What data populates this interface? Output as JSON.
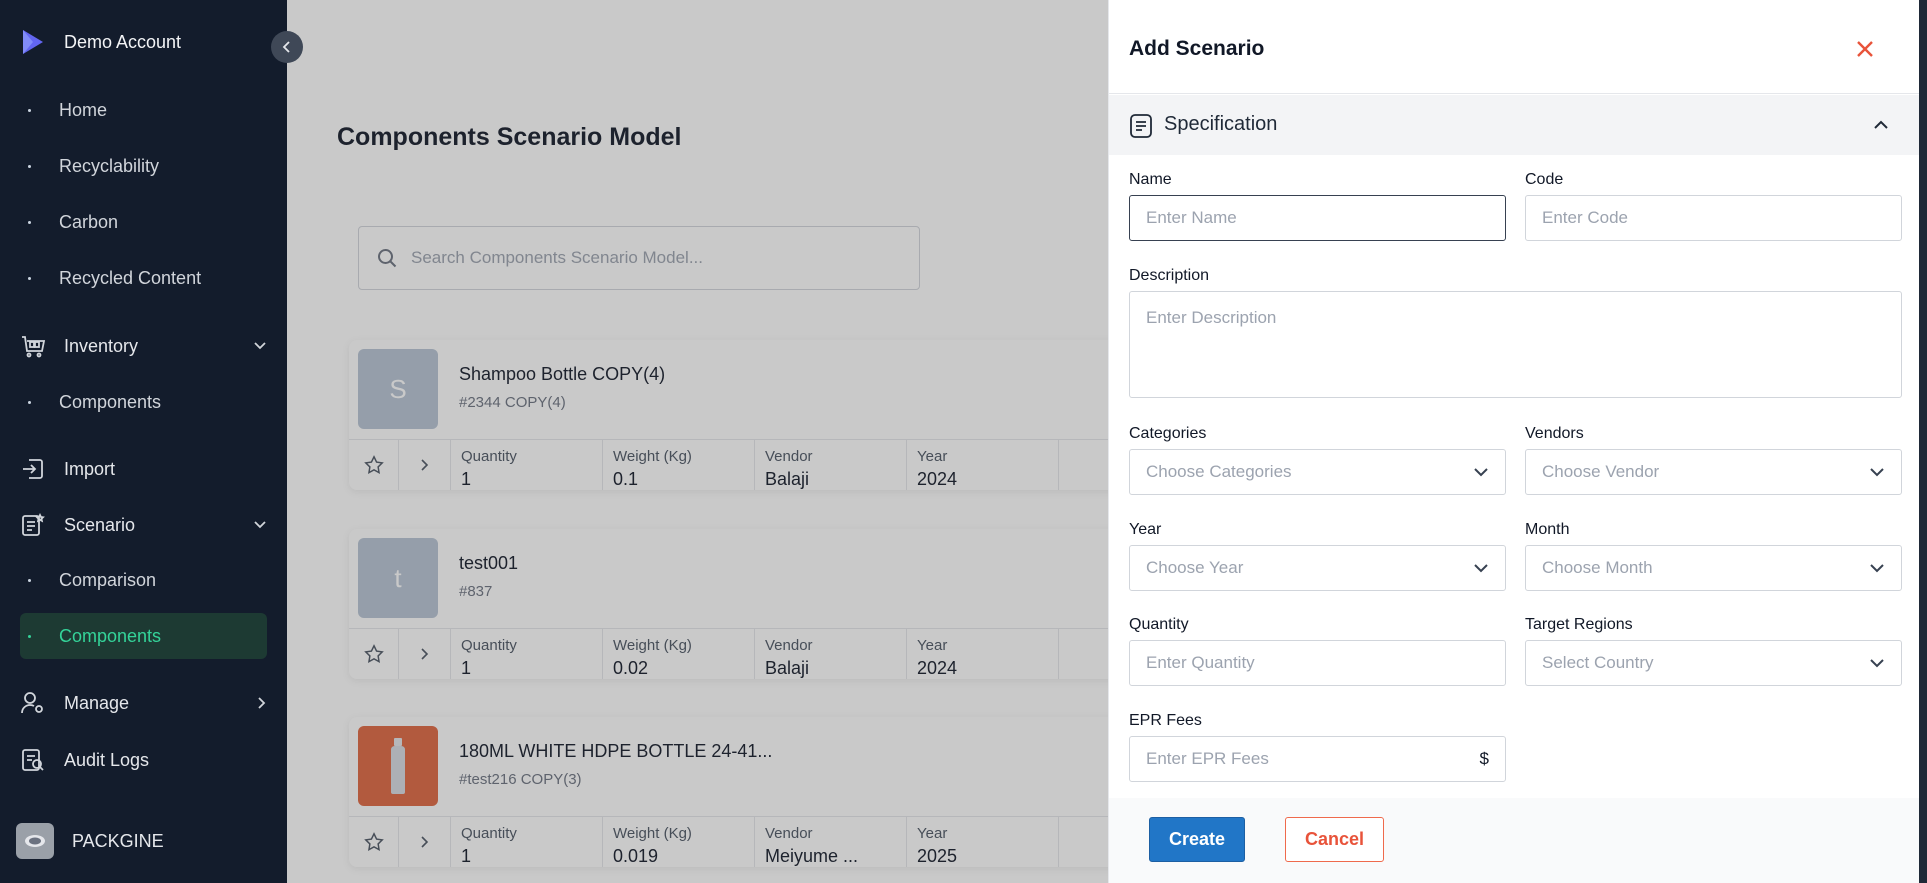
{
  "sidebar": {
    "brand": "Demo Account",
    "items": [
      {
        "label": "Home"
      },
      {
        "label": "Recyclability"
      },
      {
        "label": "Carbon"
      },
      {
        "label": "Recycled Content"
      },
      {
        "label": "Inventory"
      },
      {
        "label": "Components"
      },
      {
        "label": "Import"
      },
      {
        "label": "Scenario"
      },
      {
        "label": "Comparison"
      },
      {
        "label": "Components"
      },
      {
        "label": "Manage"
      },
      {
        "label": "Audit Logs"
      }
    ],
    "footer": "PACKGINE",
    "active_color": "#34d399"
  },
  "main": {
    "title": "Components Scenario Model",
    "search_placeholder": "Search Components Scenario Model...",
    "cards": [
      {
        "initial": "S",
        "name": "Shampoo Bottle COPY(4)",
        "code": "#2344 COPY(4)",
        "quantity": "1",
        "weight": "0.1",
        "vendor": "Balaji",
        "year": "2024"
      },
      {
        "initial": "t",
        "name": "test001",
        "code": "#837",
        "quantity": "1",
        "weight": "0.02",
        "vendor": "Balaji",
        "year": "2024"
      },
      {
        "initial": "",
        "name": "180ML WHITE HDPE BOTTLE 24-41...",
        "code": "#test216 COPY(3)",
        "quantity": "1",
        "weight": "0.019",
        "vendor": "Meiyume ...",
        "year": "2025"
      }
    ],
    "columns": {
      "quantity": "Quantity",
      "weight": "Weight (Kg)",
      "vendor": "Vendor",
      "year": "Year"
    }
  },
  "drawer": {
    "title": "Add Scenario",
    "section": "Specification",
    "fields": {
      "name": {
        "label": "Name",
        "placeholder": "Enter Name"
      },
      "code": {
        "label": "Code",
        "placeholder": "Enter Code"
      },
      "description": {
        "label": "Description",
        "placeholder": "Enter Description"
      },
      "categories": {
        "label": "Categories",
        "placeholder": "Choose Categories"
      },
      "vendors": {
        "label": "Vendors",
        "placeholder": "Choose Vendor"
      },
      "year": {
        "label": "Year",
        "placeholder": "Choose Year"
      },
      "month": {
        "label": "Month",
        "placeholder": "Choose Month"
      },
      "quantity": {
        "label": "Quantity",
        "placeholder": "Enter Quantity"
      },
      "regions": {
        "label": "Target Regions",
        "placeholder": "Select Country"
      },
      "epr": {
        "label": "EPR Fees",
        "placeholder": "Enter EPR Fees",
        "suffix": "$"
      }
    },
    "create_label": "Create",
    "cancel_label": "Cancel",
    "accent": "#2176c7",
    "danger": "#e8533a"
  }
}
